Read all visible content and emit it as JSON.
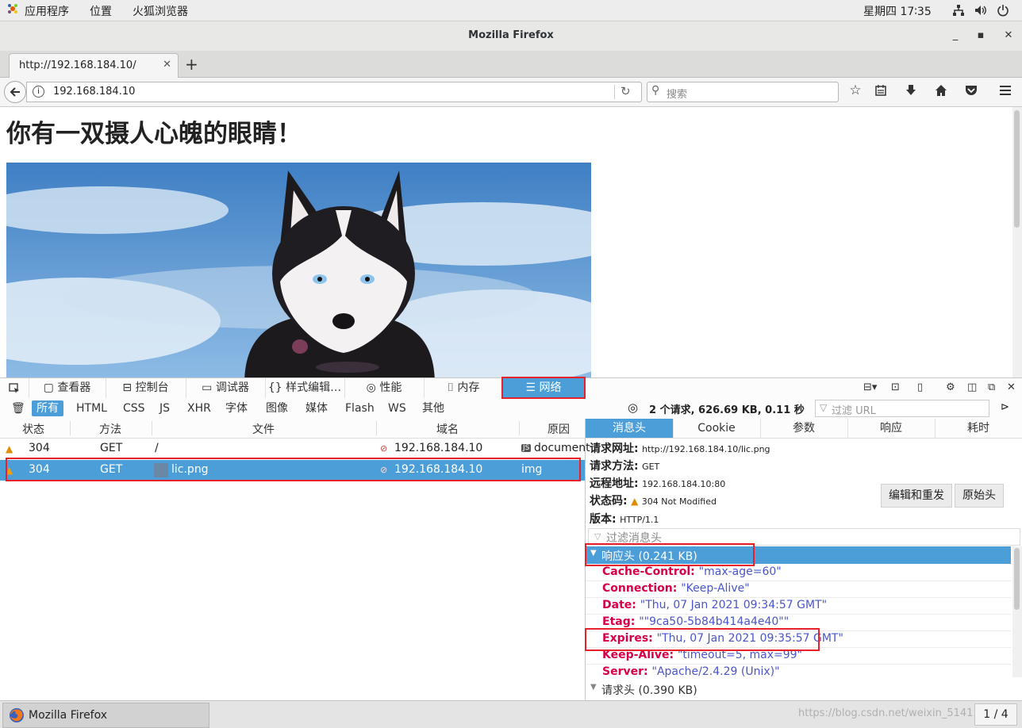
{
  "gnome_bar": {
    "apps": "应用程序",
    "places": "位置",
    "browser": "火狐浏览器",
    "clock": "星期四 17∶35"
  },
  "window": {
    "title": "Mozilla Firefox"
  },
  "tab": {
    "label": "http://192.168.184.10/",
    "close": "✕",
    "new_tab": "+"
  },
  "navbar": {
    "url": "192.168.184.10",
    "search_placeholder": "搜索"
  },
  "page": {
    "heading": "你有一双摄人心魄的眼睛！"
  },
  "devtools": {
    "tabs": [
      "查看器",
      "控制台",
      "调试器",
      "样式编辑…",
      "性能",
      "内存",
      "网络"
    ],
    "filter_types": [
      "所有",
      "HTML",
      "CSS",
      "JS",
      "XHR",
      "字体",
      "图像",
      "媒体",
      "Flash",
      "WS",
      "其他"
    ],
    "summary": "2 个请求, 626.69 KB, 0.11 秒",
    "url_filter_placeholder": "过滤 URL",
    "columns": [
      "状态",
      "方法",
      "文件",
      "域名",
      "原因"
    ],
    "requests": [
      {
        "status": "304",
        "method": "GET",
        "file": "/",
        "domain": "192.168.184.10",
        "cause": "document",
        "cause_badge": "JS"
      },
      {
        "status": "304",
        "method": "GET",
        "file": "lic.png",
        "domain": "192.168.184.10",
        "cause": "img"
      }
    ],
    "side_tabs": [
      "消息头",
      "Cookie",
      "参数",
      "响应",
      "耗时"
    ],
    "summary_fields": {
      "request_url_label": "请求网址:",
      "request_url": "http://192.168.184.10/lic.png",
      "method_label": "请求方法:",
      "method": "GET",
      "remote_label": "远程地址:",
      "remote": "192.168.184.10:80",
      "status_label": "状态码:",
      "status": "304  Not  Modified",
      "version_label": "版本:",
      "version": "HTTP/1.1"
    },
    "buttons": {
      "edit_resend": "编辑和重发",
      "raw_headers": "原始头"
    },
    "header_filter_placeholder": "过滤消息头",
    "response_headers_group": "响应头 (0.241 KB)",
    "response_headers": [
      {
        "key": "Cache-Control",
        "value": "\"max-age=60\""
      },
      {
        "key": "Connection",
        "value": "\"Keep-Alive\""
      },
      {
        "key": "Date",
        "value": "\"Thu, 07 Jan 2021 09:34:57 GMT\""
      },
      {
        "key": "Etag",
        "value": "\"\"9ca50-5b84b414a4e40\"\""
      },
      {
        "key": "Expires",
        "value": "\"Thu, 07 Jan 2021 09:35:57 GMT\""
      },
      {
        "key": "Keep-Alive",
        "value": "\"timeout=5, max=99\""
      },
      {
        "key": "Server",
        "value": "\"Apache/2.4.29 (Unix)\""
      }
    ],
    "request_headers_group": "请求头 (0.390 KB)"
  },
  "taskbar": {
    "app_label": "Mozilla Firefox",
    "watermark": "https://blog.csdn.net/weixin_5141...",
    "pager": "1 / 4"
  },
  "colors": {
    "accent": "#4c9ed9",
    "highlight": "#e8202a",
    "header_key": "#d70048",
    "header_value": "#4a55c7"
  }
}
